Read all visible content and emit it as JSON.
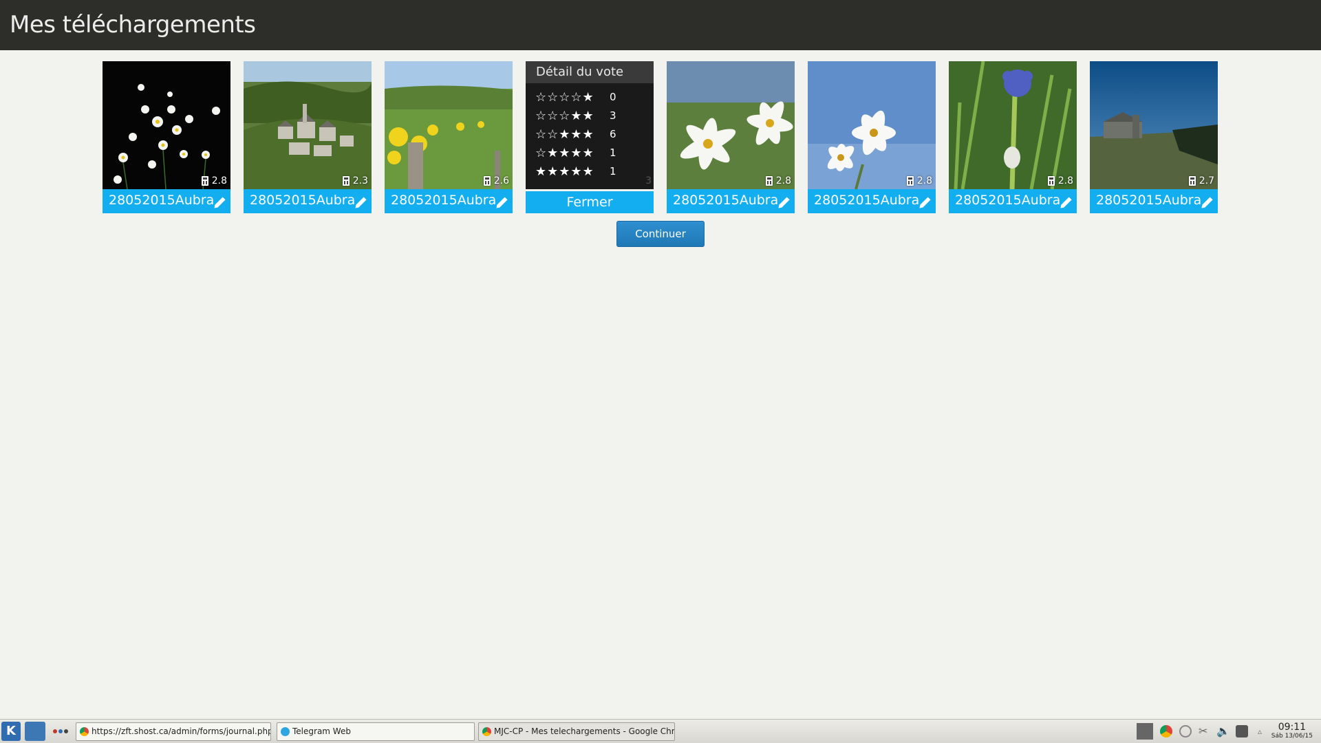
{
  "header": {
    "title": "Mes téléchargements"
  },
  "cards": [
    {
      "caption": "28052015Aubra",
      "score": "2.8",
      "image": "daisies-on-black"
    },
    {
      "caption": "28052015Aubra",
      "score": "2.3",
      "image": "stone-village-valley"
    },
    {
      "caption": "28052015Aubra",
      "score": "2.6",
      "image": "broom-meadow-fence-post"
    },
    {
      "caption": "28052015Aubra",
      "score": "2.8",
      "image": "white-narcissus"
    },
    {
      "caption": "28052015Aubra",
      "score": "2.8",
      "image": "narcissus-blue-sky"
    },
    {
      "caption": "28052015Aubra",
      "score": "2.8",
      "image": "blue-flower-grass"
    },
    {
      "caption": "28052015Aubra",
      "score": "2.7",
      "image": "plateau-farm-dusk"
    }
  ],
  "vote_detail": {
    "title": "Détail du vote",
    "rows": [
      {
        "stars": 1,
        "count": "0"
      },
      {
        "stars": 2,
        "count": "3"
      },
      {
        "stars": 3,
        "count": "6"
      },
      {
        "stars": 4,
        "count": "1"
      },
      {
        "stars": 5,
        "count": "1"
      }
    ],
    "faded_score": "3",
    "close_label": "Fermer"
  },
  "continue_label": "Continuer",
  "taskbar": {
    "tasks": [
      {
        "label": "https://zft.shost.ca/admin/forms/journal.php",
        "icon": "chrome-icon"
      },
      {
        "label": "Telegram Web",
        "icon": "telegram-icon"
      },
      {
        "label": "MJC-CP - Mes telechargements - Google Chrome",
        "icon": "chrome-icon"
      }
    ],
    "time": "09:11",
    "date": "Sáb 13/06/15"
  }
}
